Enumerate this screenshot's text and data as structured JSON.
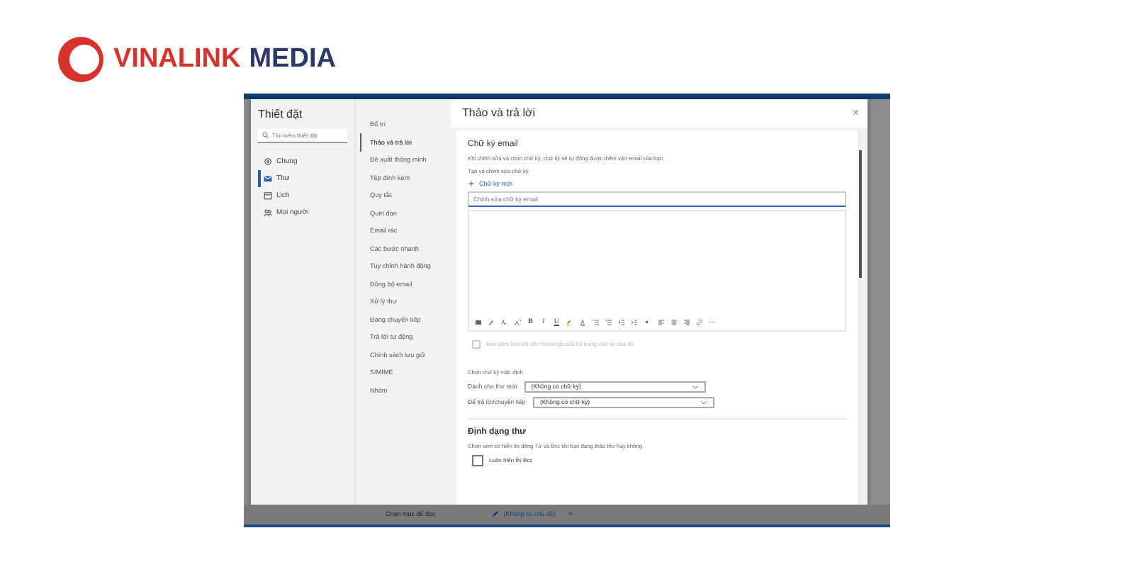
{
  "logo": {
    "brand": "VINALINK",
    "suffix": "MEDIA"
  },
  "settings": {
    "title": "Thiết đặt",
    "search": {
      "placeholder": "Tìm kiếm thiết đặt"
    },
    "nav": [
      {
        "label": "Chung",
        "selected": false
      },
      {
        "label": "Thư",
        "selected": true
      },
      {
        "label": "Lịch",
        "selected": false
      },
      {
        "label": "Mọi người",
        "selected": false
      }
    ],
    "sections": [
      {
        "label": "Bố trí",
        "selected": false
      },
      {
        "label": "Thảo và trả lời",
        "selected": true
      },
      {
        "label": "Đề xuất thông minh",
        "selected": false
      },
      {
        "label": "Tệp đính kèm",
        "selected": false
      },
      {
        "label": "Quy tắc",
        "selected": false
      },
      {
        "label": "Quét dọn",
        "selected": false
      },
      {
        "label": "Email rác",
        "selected": false
      },
      {
        "label": "Các bước nhanh",
        "selected": false
      },
      {
        "label": "Tùy chỉnh hành động",
        "selected": false
      },
      {
        "label": "Đồng bộ email",
        "selected": false
      },
      {
        "label": "Xử lý thư",
        "selected": false
      },
      {
        "label": "Đang chuyển tiếp",
        "selected": false
      },
      {
        "label": "Trả lời tự động",
        "selected": false
      },
      {
        "label": "Chính sách lưu giữ",
        "selected": false
      },
      {
        "label": "S/MIME",
        "selected": false
      },
      {
        "label": "Nhóm",
        "selected": false
      }
    ]
  },
  "panel": {
    "title": "Thảo và trả lời",
    "close": "×",
    "signature": {
      "heading": "Chữ ký email",
      "description": "Khi chỉnh sửa và chọn chữ ký, chữ ký sẽ tự động được thêm vào email của bạn.",
      "subheading": "Tạo và chỉnh sửa chữ ký",
      "new_button": "Chữ ký mới",
      "name_field": {
        "placeholder": "Chỉnh sửa chữ ký email"
      },
      "toolbar_letters": [
        "B",
        "I",
        "U"
      ],
      "bookings": {
        "label": "Bao gồm liên kết đến bookings của tôi trong chữ ký của tôi",
        "checked": false,
        "disabled": true
      }
    },
    "defaults": {
      "heading": "Chọn chữ ký mặc định",
      "rows": [
        {
          "label": "Dành cho thư mới:",
          "value": "(Không có chữ ký)"
        },
        {
          "label": "Để trả lời/chuyển tiếp:",
          "value": "(Không có chữ ký)"
        }
      ]
    },
    "format": {
      "heading": "Định dạng thư",
      "description": "Chọn xem có hiển thị dòng Từ và Bcc khi bạn đang thảo thư hay không.",
      "option": {
        "label": "Luôn hiển thị Bcc",
        "checked": false
      }
    }
  },
  "taskbar": [
    {
      "label": "Chọn mục để đọc"
    },
    {
      "label": "(Không có chủ đề)",
      "close": "×"
    }
  ]
}
